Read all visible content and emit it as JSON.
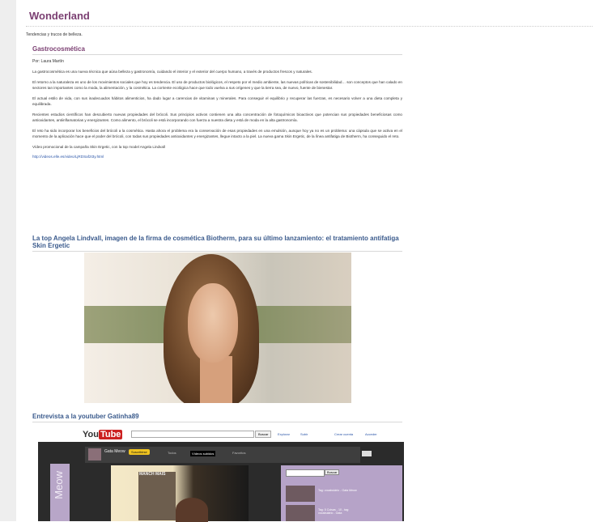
{
  "blog": {
    "title": "Wonderland",
    "tagline": "Tendencias y trucos de belleza."
  },
  "post1": {
    "title": "Gastrocosmética",
    "author": "Por: Laura Martín",
    "paragraphs": [
      "La gastrocosmética es una nueva técnica que aúna belleza y gastronomía, cuidando el interior y el exterior del cuerpo humano, a través de productos frescos y naturales.",
      "El retorno a la naturaleza es uno de los movimientos sociales que hoy es tendencia. El uso de productos biológicos, el respeto por el medio ambiente, las nuevas políticas de sostenibilidad… son conceptos que han calado en sectores tan importantes como la moda, la alimentación, y la cosmética. La corriente ecológica hace que todo vuelva a sus orígenes y que la tierra sea, de nuevo, fuente de bienestar.",
      "El actual estilo de vida, con sus inadecuados hábitos alimenticios, ha dado lugar a carencias de vitaminas y minerales. Para conseguir el equilibrio y recuperar las fuerzas, es necesario volver a una dieta completa y equilibrada.",
      "Recientes estudios científicos han descubierto nuevas propiedades del brócoli. Sus principios activos contienen una alta concentración de fotoquímicos bioactivos que potencian sus propiedades beneficiosas como antioxidantes, antiinflamatorias y energizantes. Como alimento, el brócoli se está incorporando con fuerza a nuestra dieta y está de moda en la alta gastronomía.",
      "El reto ha sido incorporar los beneficios del brócoli a la cosmética. Hasta ahora el problema era la conservación de esas propiedades en una emulsión, aunque hoy ya no es un problema: una cápsula que se activa en el momento de la aplicación hace que el poder del brócoli, con todas sus propiedades antioxidantes y energizantes, llegue intacto a la piel. La nueva gama Skin Ergetic, de la línea antifatiga de Biotherm, ha conseguido el reto.",
      "Vídeo promocional de la campaña Skin Ergetic, con la top model Angela Lindvall"
    ],
    "link": "http://videos.elle.es/video/LjRDSaf2I3y.html"
  },
  "post2": {
    "title": "La top Angela Lindvall, imagen de la firma de cosmética Biotherm, para su último lanzamiento: el tratamiento antifatiga Skin Ergetic"
  },
  "post3": {
    "title": "Entrevista a la youtuber Gatinha89"
  },
  "youtube": {
    "logo_you": "You",
    "logo_tube": "Tube",
    "search_button": "Buscar",
    "explore": "Explorar",
    "upload": "Subir",
    "create_account": "Crear cuenta",
    "sign_in": "Acceder",
    "channel_name": "Gata Meow",
    "subscribe": "Suscribirse",
    "tab_all": "Todos",
    "tab_uploads": "Vídeos subidos",
    "tab_favorites": "Favoritos",
    "side_search_button": "Buscar",
    "poster_text": "MANCH MAIS",
    "meow_text": "Meow",
    "side_items": [
      "Tag: vocabulário - Gata Meow",
      "Tag: 5 Coisas - 10 - tag: vocabulário - Gata"
    ]
  },
  "colors": {
    "accent": "#7b3f72",
    "post_blue": "#3a5a8c",
    "link": "#2a55a8"
  }
}
